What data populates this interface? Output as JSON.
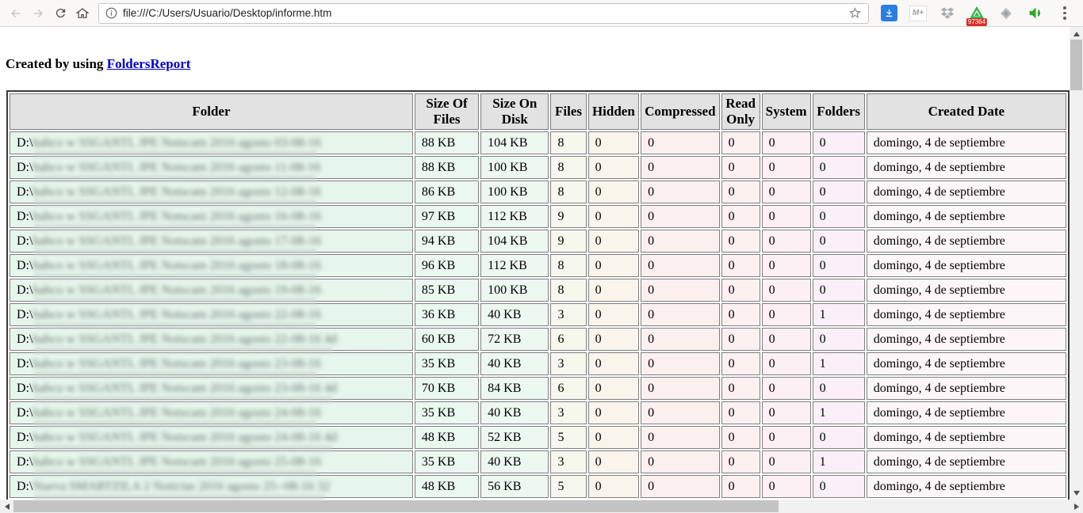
{
  "browser": {
    "url": "file:///C:/Users/Usuario/Desktop/informe.htm",
    "extension_badge": "97364"
  },
  "page": {
    "heading_prefix": "Created by using ",
    "heading_link": "FoldersReport"
  },
  "table": {
    "headers": [
      "Folder",
      "Size Of Files",
      "Size On Disk",
      "Files",
      "Hidden",
      "Compressed",
      "Read Only",
      "System",
      "Folders",
      "Created Date"
    ],
    "column_colors": {
      "folder": "#e7f6ec",
      "size_of_files": "#eaf8ef",
      "size_on_disk": "#edf8f0",
      "files": "#f6f8ee",
      "hidden": "#faf5ec",
      "compressed": "#fcf0ef",
      "read_only": "#fdf0f1",
      "system": "#fdf0f4",
      "folders": "#fbf0f8",
      "created": "#fdf6f9"
    },
    "rows": [
      {
        "path_prefix": "D:\\",
        "path_redacted": "habco w SSGANTL JPE Notscam 2016 agosto 03-08-16",
        "size_of_files": "88 KB",
        "size_on_disk": "104 KB",
        "files": "8",
        "hidden": "0",
        "compressed": "0",
        "read_only": "0",
        "system": "0",
        "folders": "0",
        "created": "domingo, 4 de septiembre"
      },
      {
        "path_prefix": "D:\\",
        "path_redacted": "habco w SSGANTL JPE Notscam 2016 agosto 11-08-16",
        "size_of_files": "88 KB",
        "size_on_disk": "100 KB",
        "files": "8",
        "hidden": "0",
        "compressed": "0",
        "read_only": "0",
        "system": "0",
        "folders": "0",
        "created": "domingo, 4 de septiembre"
      },
      {
        "path_prefix": "D:\\",
        "path_redacted": "habco w SSGANTL JPE Notscam 2016 agosto 12-08-16",
        "size_of_files": "86 KB",
        "size_on_disk": "100 KB",
        "files": "8",
        "hidden": "0",
        "compressed": "0",
        "read_only": "0",
        "system": "0",
        "folders": "0",
        "created": "domingo, 4 de septiembre"
      },
      {
        "path_prefix": "D:\\",
        "path_redacted": "habco w SSGANTL JPE Notscam 2016 agosto 16-08-16",
        "size_of_files": "97 KB",
        "size_on_disk": "112 KB",
        "files": "9",
        "hidden": "0",
        "compressed": "0",
        "read_only": "0",
        "system": "0",
        "folders": "0",
        "created": "domingo, 4 de septiembre"
      },
      {
        "path_prefix": "D:\\",
        "path_redacted": "habco w SSGANTL JPE Notscam 2016 agosto 17-08-16",
        "size_of_files": "94 KB",
        "size_on_disk": "104 KB",
        "files": "9",
        "hidden": "0",
        "compressed": "0",
        "read_only": "0",
        "system": "0",
        "folders": "0",
        "created": "domingo, 4 de septiembre"
      },
      {
        "path_prefix": "D:\\",
        "path_redacted": "habco w SSGANTL JPE Notscam 2016 agosto 18-08-16",
        "size_of_files": "96 KB",
        "size_on_disk": "112 KB",
        "files": "8",
        "hidden": "0",
        "compressed": "0",
        "read_only": "0",
        "system": "0",
        "folders": "0",
        "created": "domingo, 4 de septiembre"
      },
      {
        "path_prefix": "D:\\",
        "path_redacted": "habco w SSGANTL JPE Notscam 2016 agosto 19-08-16",
        "size_of_files": "85 KB",
        "size_on_disk": "100 KB",
        "files": "8",
        "hidden": "0",
        "compressed": "0",
        "read_only": "0",
        "system": "0",
        "folders": "0",
        "created": "domingo, 4 de septiembre"
      },
      {
        "path_prefix": "D:\\",
        "path_redacted": "habco w SSGANTL JPE Notscam 2016 agosto 22-08-16",
        "size_of_files": "36 KB",
        "size_on_disk": "40 KB",
        "files": "3",
        "hidden": "0",
        "compressed": "0",
        "read_only": "0",
        "system": "0",
        "folders": "1",
        "created": "domingo, 4 de septiembre"
      },
      {
        "path_prefix": "D:\\",
        "path_redacted": "habco w SSGANTL JPE Notscam 2016 agosto 22-08-16 4d",
        "size_of_files": "60 KB",
        "size_on_disk": "72 KB",
        "files": "6",
        "hidden": "0",
        "compressed": "0",
        "read_only": "0",
        "system": "0",
        "folders": "0",
        "created": "domingo, 4 de septiembre"
      },
      {
        "path_prefix": "D:\\",
        "path_redacted": "habco w SSGANTL JPE Notscam 2016 agosto 23-08-16",
        "size_of_files": "35 KB",
        "size_on_disk": "40 KB",
        "files": "3",
        "hidden": "0",
        "compressed": "0",
        "read_only": "0",
        "system": "0",
        "folders": "1",
        "created": "domingo, 4 de septiembre"
      },
      {
        "path_prefix": "D:\\",
        "path_redacted": "habco w SSGANTL JPE Notscam 2016 agosto 23-08-16 4d",
        "size_of_files": "70 KB",
        "size_on_disk": "84 KB",
        "files": "6",
        "hidden": "0",
        "compressed": "0",
        "read_only": "0",
        "system": "0",
        "folders": "0",
        "created": "domingo, 4 de septiembre"
      },
      {
        "path_prefix": "D:\\",
        "path_redacted": "habco w SSGANTL JPE Notscam 2016 agosto 24-08-16",
        "size_of_files": "35 KB",
        "size_on_disk": "40 KB",
        "files": "3",
        "hidden": "0",
        "compressed": "0",
        "read_only": "0",
        "system": "0",
        "folders": "1",
        "created": "domingo, 4 de septiembre"
      },
      {
        "path_prefix": "D:\\",
        "path_redacted": "habco w SSGANTL JPE Notscam 2016 agosto 24-08-16 4d",
        "size_of_files": "48 KB",
        "size_on_disk": "52 KB",
        "files": "5",
        "hidden": "0",
        "compressed": "0",
        "read_only": "0",
        "system": "0",
        "folders": "0",
        "created": "domingo, 4 de septiembre"
      },
      {
        "path_prefix": "D:\\",
        "path_redacted": "habco w SSGANTL JPE Notscam 2016 agosto 25-08-16",
        "size_of_files": "35 KB",
        "size_on_disk": "40 KB",
        "files": "3",
        "hidden": "0",
        "compressed": "0",
        "read_only": "0",
        "system": "0",
        "folders": "1",
        "created": "domingo, 4 de septiembre"
      },
      {
        "path_prefix": "D:\\",
        "path_redacted": "Nueva SMARTZILA 2 Noticias 2016 agosto 25--08-16 32",
        "size_of_files": "48 KB",
        "size_on_disk": "56 KB",
        "files": "5",
        "hidden": "0",
        "compressed": "0",
        "read_only": "0",
        "system": "0",
        "folders": "0",
        "created": "domingo, 4 de septiembre"
      }
    ]
  }
}
